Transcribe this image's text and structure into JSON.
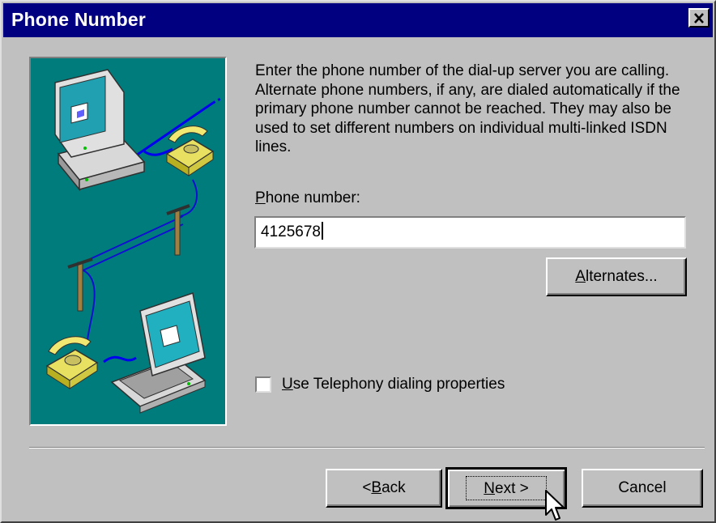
{
  "window": {
    "title": "Phone Number",
    "close_glyph": "✕"
  },
  "description": "Enter the phone number of the dial-up server you are calling.  Alternate phone numbers, if any, are dialed automatically if the primary phone number cannot be reached.  They may also be used to set different numbers on individual multi-linked ISDN lines.",
  "phone": {
    "label_accel": "P",
    "label_rest": "hone number:",
    "value": "4125678"
  },
  "buttons": {
    "alternates_accel": "A",
    "alternates_rest": "lternates...",
    "back_prefix": "< ",
    "back_accel": "B",
    "back_rest": "ack",
    "next_accel": "N",
    "next_rest": "ext >",
    "cancel": "Cancel"
  },
  "telephony": {
    "checked": false,
    "label_accel": "U",
    "label_rest": "se Telephony dialing properties"
  },
  "colors": {
    "title_bar": "#000080",
    "face": "#c0c0c0",
    "illustration_bg": "#007c7c"
  },
  "icons": [
    "close-icon",
    "desktop-computer-icon",
    "telephone-icon",
    "telephone-pole-icon",
    "laptop-icon",
    "mouse-pointer-icon"
  ]
}
